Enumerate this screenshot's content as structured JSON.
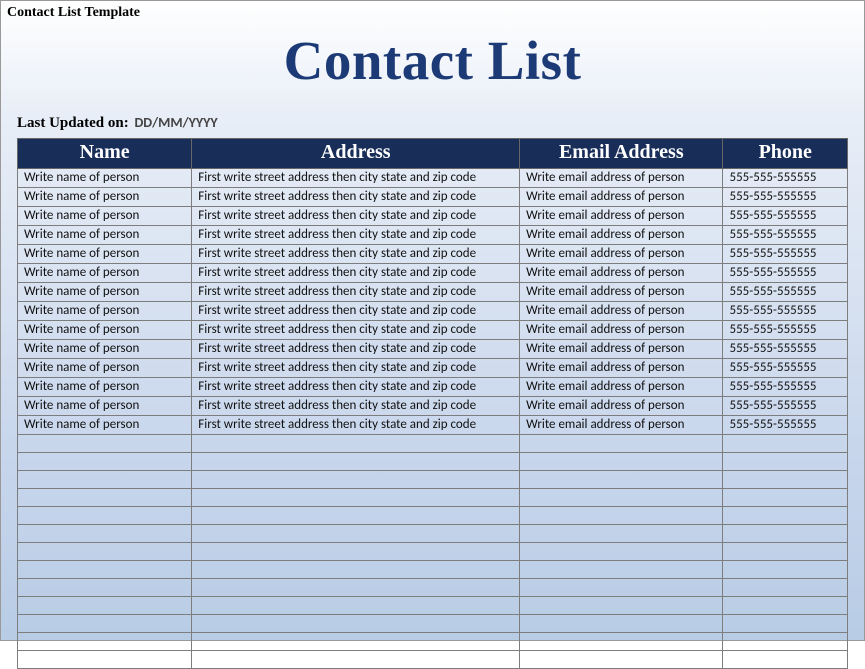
{
  "doc": {
    "title": "Contact List Template"
  },
  "heading": "Contact List",
  "meta": {
    "label": "Last Updated on:",
    "value": "DD/MM/YYYY"
  },
  "columns": {
    "name": "Name",
    "address": "Address",
    "email": "Email Address",
    "phone": "Phone"
  },
  "placeholders": {
    "name": "Write name of person",
    "address": "First write street address then city state and zip code",
    "email": "Write email address of person",
    "phone": "555-555-555555"
  },
  "filled_rows": 14,
  "empty_rows": 13
}
